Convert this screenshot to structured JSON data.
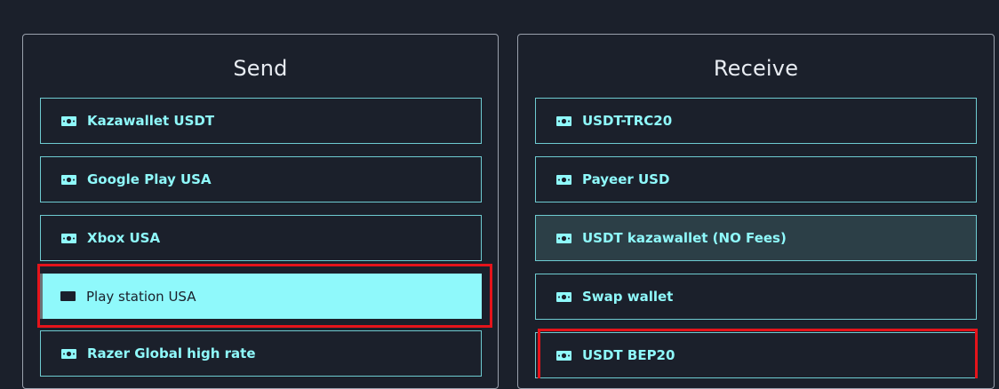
{
  "send": {
    "title": "Send",
    "options": [
      {
        "label": "Kazawallet USDT",
        "icon": "money-icon"
      },
      {
        "label": "Google Play USA",
        "icon": "money-icon"
      },
      {
        "label": "Xbox USA",
        "icon": "money-icon"
      },
      {
        "label": "Play station USA",
        "icon": "money-icon",
        "selected": true
      },
      {
        "label": "Razer Global high rate",
        "icon": "money-icon"
      }
    ]
  },
  "receive": {
    "title": "Receive",
    "options": [
      {
        "label": "USDT-TRC20",
        "icon": "money-icon"
      },
      {
        "label": "Payeer USD",
        "icon": "money-icon"
      },
      {
        "label": "USDT kazawallet (NO Fees)",
        "icon": "money-icon",
        "hovered": true
      },
      {
        "label": "Swap wallet",
        "icon": "money-icon"
      },
      {
        "label": "USDT BEP20",
        "icon": "money-icon"
      }
    ]
  },
  "colors": {
    "background": "#1b202b",
    "accent": "#8ff9fb",
    "highlight_box": "#e5141b"
  }
}
